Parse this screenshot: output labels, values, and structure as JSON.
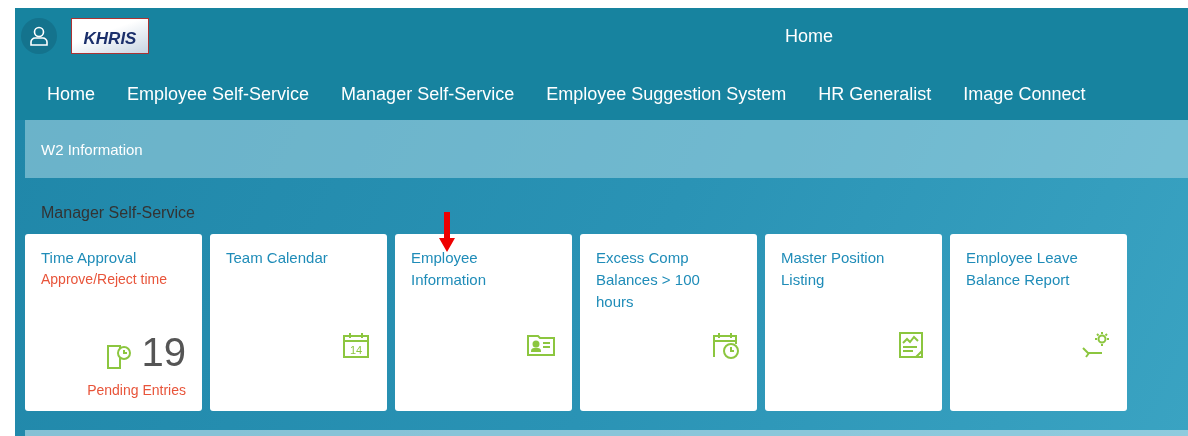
{
  "header": {
    "logo": "KHRIS",
    "title": "Home"
  },
  "nav": [
    {
      "label": "Home",
      "selected": false
    },
    {
      "label": "Employee Self-Service",
      "selected": false
    },
    {
      "label": "Manager Self-Service",
      "selected": false
    },
    {
      "label": "Employee Suggestion System",
      "selected": false
    },
    {
      "label": "HR Generalist",
      "selected": false
    },
    {
      "label": "Image Connect",
      "selected": false
    }
  ],
  "links": [
    "W2 Information"
  ],
  "section": {
    "title": "Manager Self-Service"
  },
  "tiles": [
    {
      "title": "Time Approval",
      "subtitle": "Approve/Reject time",
      "kind": "count",
      "count": "19",
      "footer": "Pending Entries"
    },
    {
      "title": "Team Calendar",
      "kind": "icon",
      "icon_text": "14"
    },
    {
      "title": "Employee Information",
      "kind": "icon"
    },
    {
      "title": "Excess Comp Balances > 100 hours",
      "kind": "icon"
    },
    {
      "title": "Master Position Listing",
      "kind": "icon"
    },
    {
      "title": "Employee Leave Balance Report",
      "kind": "icon"
    }
  ]
}
